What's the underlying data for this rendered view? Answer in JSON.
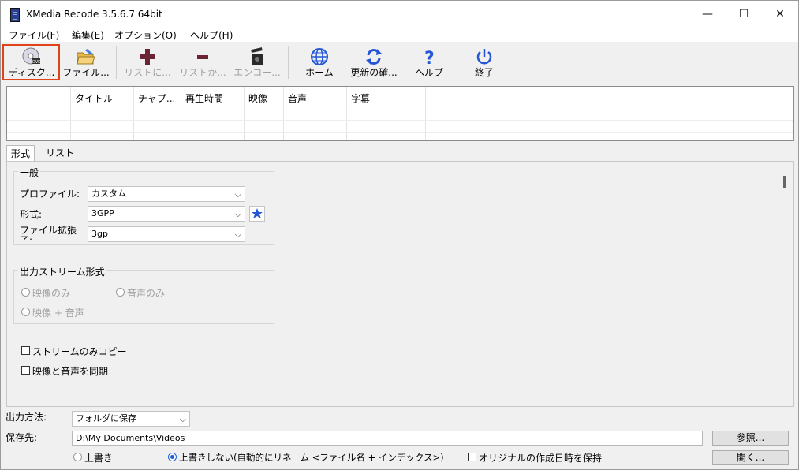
{
  "window": {
    "title": "XMedia Recode 3.5.6.7 64bit",
    "minimize": "—",
    "maximize": "☐",
    "close": "✕"
  },
  "menu": [
    "ファイル(F)",
    "編集(E)",
    "オプション(O)",
    "ヘルプ(H)"
  ],
  "toolbar": {
    "disc": "ディスク...",
    "file": "ファイル...",
    "add_list": "リストに...",
    "remove_list": "リストか...",
    "encode": "エンコー...",
    "home": "ホーム",
    "update": "更新の確...",
    "help": "ヘルプ",
    "exit": "終了"
  },
  "filelist": {
    "columns": [
      "",
      "タイトル",
      "チャプ...",
      "再生時間",
      "映像",
      "音声",
      "字幕"
    ]
  },
  "tabs": [
    "形式",
    "リスト"
  ],
  "general": {
    "title": "一般",
    "profile_label": "プロファイル:",
    "profile_value": "カスタム",
    "format_label": "形式:",
    "format_value": "3GPP",
    "ext_label": "ファイル拡張子:",
    "ext_value": "3gp"
  },
  "stream": {
    "title": "出力ストリーム形式",
    "video_only": "映像のみ",
    "audio_only": "音声のみ",
    "video_audio": "映像 + 音声"
  },
  "options": {
    "stream_copy": "ストリームのみコピー",
    "sync": "映像と音声を同期"
  },
  "output": {
    "method_label": "出力方法:",
    "method_value": "フォルダに保存",
    "dest_label": "保存先:",
    "dest_value": "D:\\My Documents\\Videos",
    "browse": "参照...",
    "open": "開く...",
    "overwrite": "上書き",
    "no_overwrite": "上書きしない(自動的にリネーム <ファイル名 + インデックス>)",
    "keep_date": "オリジナルの作成日時を保持"
  },
  "colors": {
    "accent": "#e0421a",
    "icon_blue": "#2456d6",
    "icon_dark": "#6b2434"
  }
}
